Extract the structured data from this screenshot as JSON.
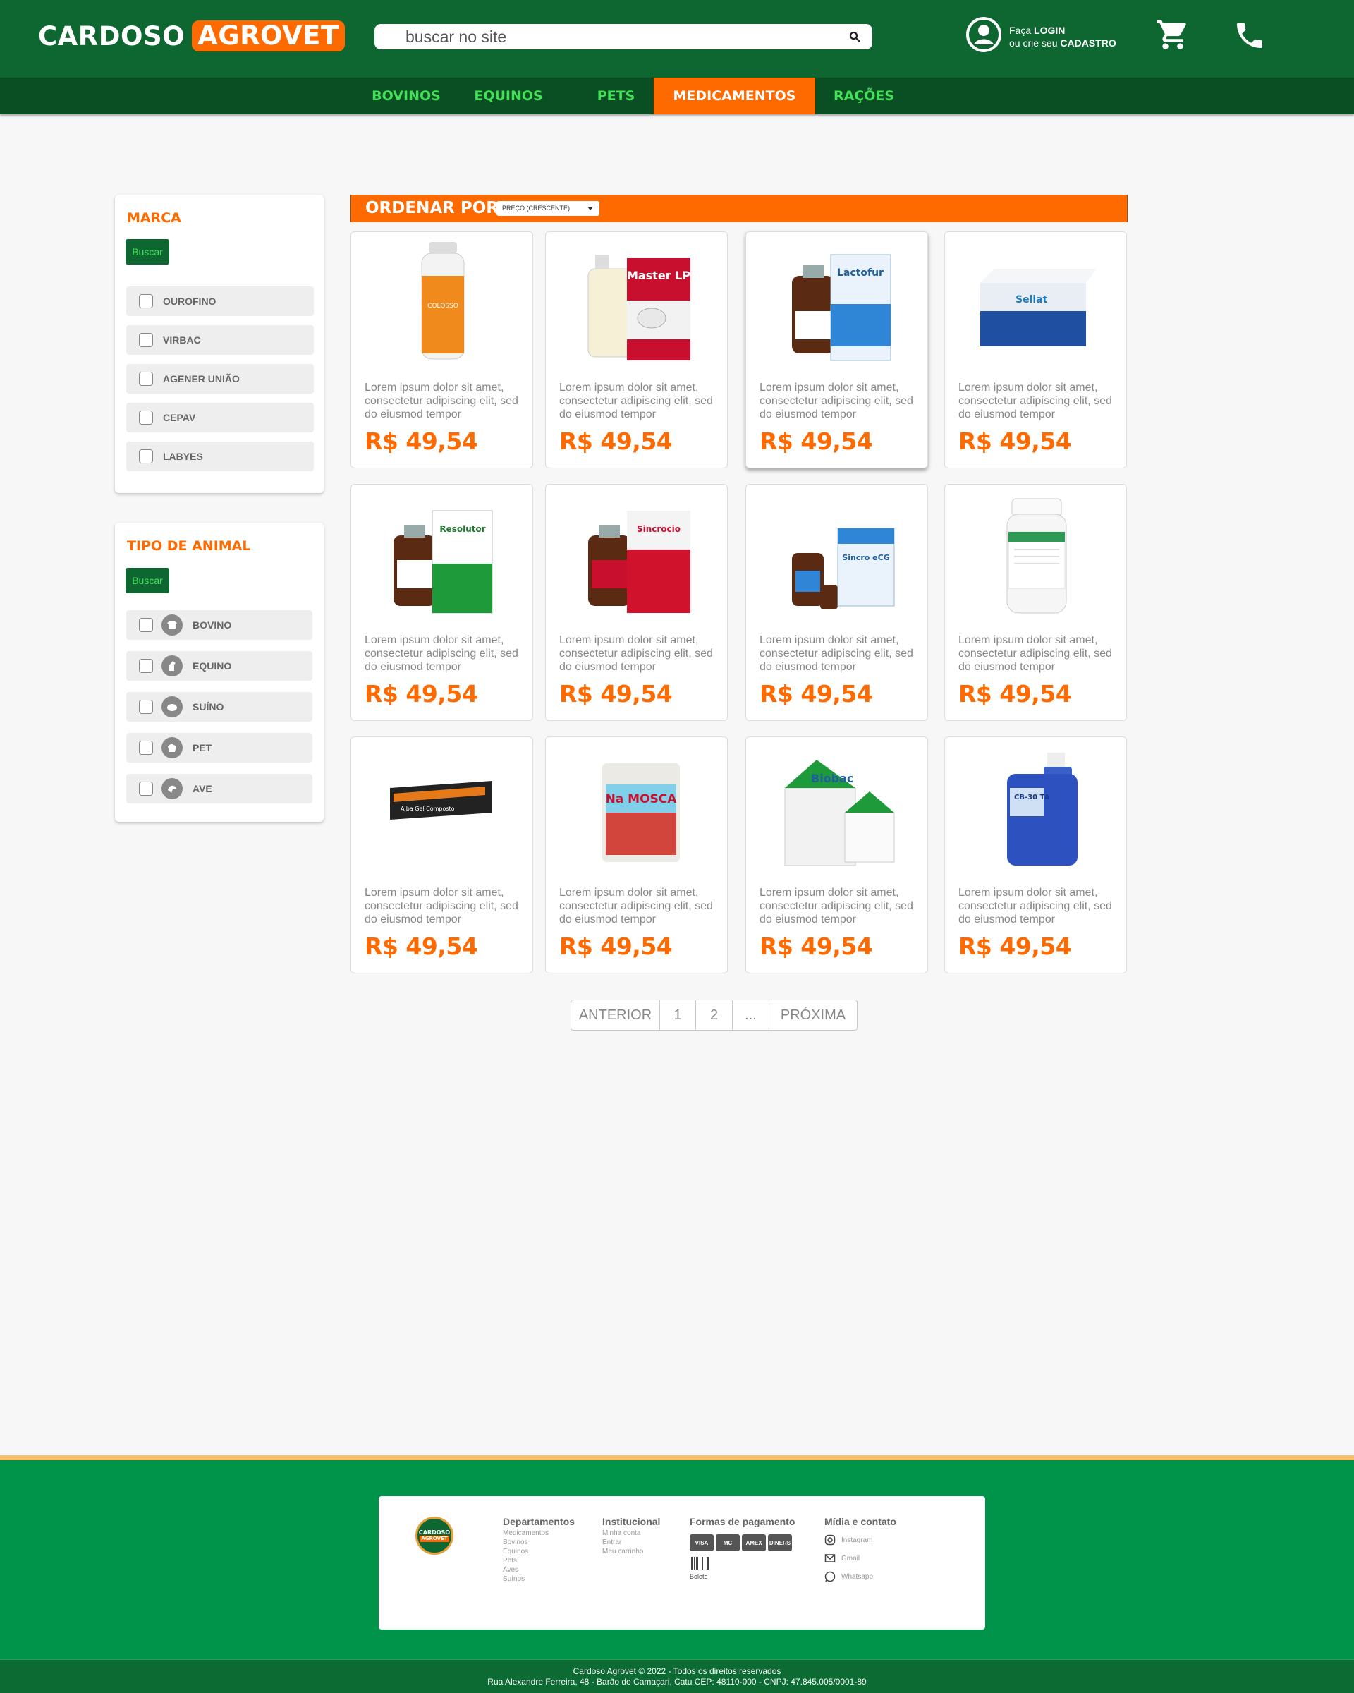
{
  "header": {
    "logo_part1": "CARDOSO",
    "logo_part2": "AGROVET",
    "search_placeholder": "buscar no site",
    "login_prefix": "Faça ",
    "login_bold": "LOGIN",
    "register_prefix": "ou crie seu ",
    "register_bold": "CADASTRO"
  },
  "nav": {
    "items": [
      "BOVINOS",
      "EQUINOS",
      "PETS",
      "MEDICAMENTOS",
      "RAÇÕES"
    ],
    "active": "MEDICAMENTOS"
  },
  "filters": {
    "brand": {
      "title": "MARCA",
      "button": "Buscar",
      "options": [
        "OUROFINO",
        "VIRBAC",
        "AGENER UNIÃO",
        "CEPAV",
        "LABYES"
      ]
    },
    "animal": {
      "title": "TIPO DE ANIMAL",
      "button": "Buscar",
      "options": [
        "BOVINO",
        "EQUINO",
        "SUÍNO",
        "PET",
        "AVE"
      ]
    }
  },
  "sort": {
    "label": "ORDENAR POR",
    "selected": "PREÇO (CRESCENTE)"
  },
  "products": [
    {
      "brand_label": "COLOSSO",
      "description": "Lorem ipsum dolor sit amet, consectetur adipiscing elit, sed do eiusmod tempor",
      "price": "R$ 49,54"
    },
    {
      "brand_label": "Master LP",
      "description": "Lorem ipsum dolor sit amet, consectetur adipiscing elit, sed do eiusmod tempor",
      "price": "R$ 49,54"
    },
    {
      "brand_label": "Lactofur",
      "description": "Lorem ipsum dolor sit amet, consectetur adipiscing elit, sed do eiusmod tempor",
      "price": "R$ 49,54"
    },
    {
      "brand_label": "Sellat",
      "description": "Lorem ipsum dolor sit amet, consectetur adipiscing elit, sed do eiusmod tempor",
      "price": "R$ 49,54"
    },
    {
      "brand_label": "Resolutor",
      "description": "Lorem ipsum dolor sit amet, consectetur adipiscing elit, sed do eiusmod tempor",
      "price": "R$ 49,54"
    },
    {
      "brand_label": "Sincrocio",
      "description": "Lorem ipsum dolor sit amet, consectetur adipiscing elit, sed do eiusmod tempor",
      "price": "R$ 49,54"
    },
    {
      "brand_label": "Sincro eCG",
      "description": "Lorem ipsum dolor sit amet, consectetur adipiscing elit, sed do eiusmod tempor",
      "price": "R$ 49,54"
    },
    {
      "brand_label": "",
      "description": "Lorem ipsum dolor sit amet, consectetur adipiscing elit, sed do eiusmod tempor",
      "price": "R$ 49,54"
    },
    {
      "brand_label": "Alba Gel Composto",
      "description": "Lorem ipsum dolor sit amet, consectetur adipiscing elit, sed do eiusmod tempor",
      "price": "R$ 49,54"
    },
    {
      "brand_label": "Na MOSCA",
      "description": "Lorem ipsum dolor sit amet, consectetur adipiscing elit, sed do eiusmod tempor",
      "price": "R$ 49,54"
    },
    {
      "brand_label": "Biobac",
      "description": "Lorem ipsum dolor sit amet, consectetur adipiscing elit, sed do eiusmod tempor",
      "price": "R$ 49,54"
    },
    {
      "brand_label": "CB-30 TA",
      "description": "Lorem ipsum dolor sit amet, consectetur adipiscing elit, sed do eiusmod tempor",
      "price": "R$ 49,54"
    }
  ],
  "pagination": {
    "prev": "ANTERIOR",
    "pages": [
      "1",
      "2",
      "..."
    ],
    "next": "PRÓXIMA"
  },
  "footer": {
    "logo_part1": "CARDOSO",
    "logo_part2": "AGROVET",
    "departamentos": {
      "title": "Departamentos",
      "items": [
        "Medicamentos",
        "Bovinos",
        "Equinos",
        "Pets",
        "Aves",
        "Suínos"
      ]
    },
    "institucional": {
      "title": "Institucional",
      "items": [
        "Minha conta",
        "Entrar",
        "Meu carrinho"
      ]
    },
    "pagamento": {
      "title": "Formas de pagamento",
      "cards": [
        "VISA",
        "MC",
        "AMEX",
        "DINERS"
      ],
      "boleto": "Boleto"
    },
    "contato": {
      "title": "Mídia e contato",
      "items": [
        "Instagram",
        "Gmail",
        "Whatsapp"
      ]
    },
    "copyright": "Cardoso Agrovet  © 2022 - Todos os direitos reservados",
    "address": "Rua Alexandre Ferreira, 48 - Barão de Camaçari, Catu CEP: 48110-000 - CNPJ: 47.845.005/0001-89"
  },
  "colors": {
    "brand_green": "#0e6630",
    "accent_orange": "#ff6a00",
    "nav_green": "#45e05a",
    "footer_green": "#00944a"
  }
}
